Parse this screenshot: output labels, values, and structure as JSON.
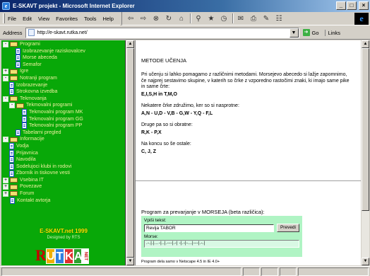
{
  "window": {
    "title": "E-SKAVT projekt - Microsoft Internet Explorer",
    "app_icon_letter": "e",
    "buttons": {
      "minimize": "_",
      "maximize": "□",
      "close": "×"
    }
  },
  "menu": [
    "File",
    "Edit",
    "View",
    "Favorites",
    "Tools",
    "Help"
  ],
  "toolbar": {
    "icons": [
      "back-icon",
      "forward-icon",
      "stop-icon",
      "refresh-icon",
      "home-icon",
      "search-icon",
      "favorites-icon",
      "history-icon",
      "mail-icon",
      "print-icon",
      "edit-icon",
      "discuss-icon"
    ]
  },
  "address": {
    "label": "Address",
    "url": "http://e-skavt.rutka.net/",
    "go_label": "Go",
    "links_label": "Links"
  },
  "tree": [
    {
      "level": 0,
      "type": "folder",
      "twisty": "-",
      "label": "Programi"
    },
    {
      "level": 2,
      "type": "doc",
      "label": "Izobrazevanje raziskovalcev"
    },
    {
      "level": 2,
      "type": "doc",
      "label": "Morse abeceda"
    },
    {
      "level": 2,
      "type": "doc",
      "label": "Semafor"
    },
    {
      "level": 0,
      "type": "folder",
      "twisty": "+",
      "label": "Igre"
    },
    {
      "level": 0,
      "type": "folder",
      "twisty": "-",
      "label": "Notranji program"
    },
    {
      "level": 1,
      "type": "doc",
      "label": "Izobrazevanje"
    },
    {
      "level": 1,
      "type": "doc",
      "label": "Strokovna izvedba"
    },
    {
      "level": 0,
      "type": "folder",
      "twisty": "-",
      "label": "Tekmovanja"
    },
    {
      "level": 1,
      "type": "folder",
      "twisty": "-",
      "label": "Tekmovalni programi"
    },
    {
      "level": 3,
      "type": "doc",
      "label": "Tekmovalni program MK"
    },
    {
      "level": 3,
      "type": "doc",
      "label": "Tekmovalni program GG"
    },
    {
      "level": 3,
      "type": "doc",
      "label": "Tekmovalni program PP"
    },
    {
      "level": 2,
      "type": "doc",
      "label": "Tabelarni pregled"
    },
    {
      "level": 0,
      "type": "folder",
      "twisty": "-",
      "label": "Informacije"
    },
    {
      "level": 1,
      "type": "doc",
      "label": "Vodja"
    },
    {
      "level": 1,
      "type": "doc",
      "label": "Prijavnica"
    },
    {
      "level": 1,
      "type": "doc",
      "label": "Navodila"
    },
    {
      "level": 1,
      "type": "doc",
      "label": "Sodelujoci klubi in rodovi"
    },
    {
      "level": 1,
      "type": "doc",
      "label": "Zbornik in tiskovne vesti"
    },
    {
      "level": 0,
      "type": "folder",
      "twisty": "+",
      "label": "Vsebina IT"
    },
    {
      "level": 0,
      "type": "folder",
      "twisty": "+",
      "label": "Povezave"
    },
    {
      "level": 0,
      "type": "folder",
      "twisty": "+",
      "label": "Forum"
    },
    {
      "level": 0,
      "type": "doc",
      "label": "Kontakt avtorja"
    }
  ],
  "left_footer": {
    "site": "E-SKAVT.net 1999",
    "credit": "Designed by RTS",
    "logo_letters": [
      "R",
      "U",
      "T",
      "K",
      "A"
    ],
    "logo_net": "NET"
  },
  "content": {
    "title": "METODE UČENJA",
    "intro": "Pri učenju si lahko pomagamo z različnimi metodami. Morsejevo abecedo si lažje zapomnimo, če najprej sestavimo skupine, v katerih so črke z vzporedno rastočimi znaki, ki imajo same pike in same črte:",
    "group1": "E,I,S,H in T,M,O",
    "para2": "Nekatere črke združimo, ker so si nasprotne:",
    "group2": "A,N - U,D - V,B - G,W - Y,Q - F,L",
    "para3": "Druge pa so si obratne:",
    "group3": "R,K - P,X",
    "para4": "Na koncu so še ostale:",
    "group4": "C, J, Z"
  },
  "morse_tool": {
    "title": "Program za prevarjanje v MORSEJA (beta različica):",
    "input_label": "Vpiši tekst:",
    "input_value": "Revija TABOR",
    "button_label": "Prevedi",
    "output_label": "Morse:",
    "output_value": ".-.|.|...-|..|.---|.-|  -|.-|-...|---|.-.|",
    "footer": "Program dela samo v Netscape 4.5 in IE 4.0+"
  }
}
